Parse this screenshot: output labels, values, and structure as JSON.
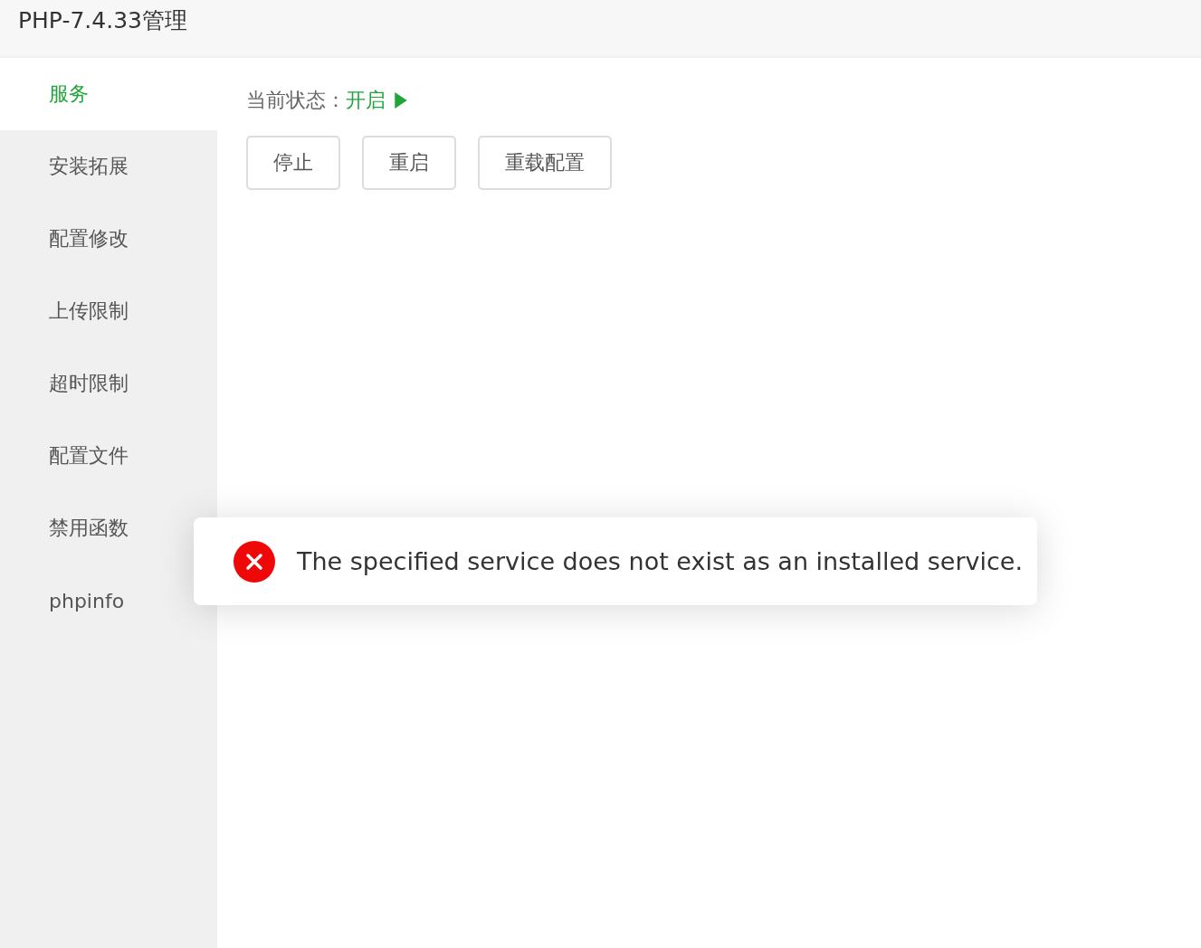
{
  "window": {
    "title": "PHP-7.4.33管理"
  },
  "sidebar": {
    "items": [
      {
        "label": "服务",
        "selected": true
      },
      {
        "label": "安装拓展",
        "selected": false
      },
      {
        "label": "配置修改",
        "selected": false
      },
      {
        "label": "上传限制",
        "selected": false
      },
      {
        "label": "超时限制",
        "selected": false
      },
      {
        "label": "配置文件",
        "selected": false
      },
      {
        "label": "禁用函数",
        "selected": false
      },
      {
        "label": "phpinfo",
        "selected": false
      }
    ]
  },
  "status": {
    "label": "当前状态：",
    "value": "开启",
    "running": true
  },
  "buttons": [
    "停止",
    "重启",
    "重载配置"
  ],
  "toast": {
    "kind": "error",
    "message": "The specified service does not exist as an installed service."
  }
}
